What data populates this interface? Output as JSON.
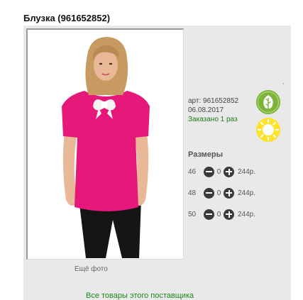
{
  "product": {
    "title": "Блузка (961652852)",
    "article": "арт: 961652852",
    "date": "06.08.2017",
    "ordered": "Заказано 1 раз"
  },
  "photo": {
    "more_label": "Ещё фото",
    "colors": {
      "blouse": "#e6197a",
      "trousers": "#151515",
      "bow": "#f4f4f4",
      "hair": "#c79a62",
      "skin": "#e9b896"
    }
  },
  "badges": {
    "eco": {
      "icon": "leaf-icon",
      "color": "#7db33a"
    },
    "sun": {
      "icon": "sun-icon",
      "color": "#ffe22a"
    }
  },
  "sizes": {
    "heading": "Размеры",
    "rows": [
      {
        "size": "46",
        "qty": "0",
        "price": "244р."
      },
      {
        "size": "48",
        "qty": "0",
        "price": "244р."
      },
      {
        "size": "50",
        "qty": "0",
        "price": "244р."
      }
    ]
  },
  "footer": {
    "supplier_link": "Все товары этого поставщика"
  },
  "misc": {
    "dot": ","
  }
}
